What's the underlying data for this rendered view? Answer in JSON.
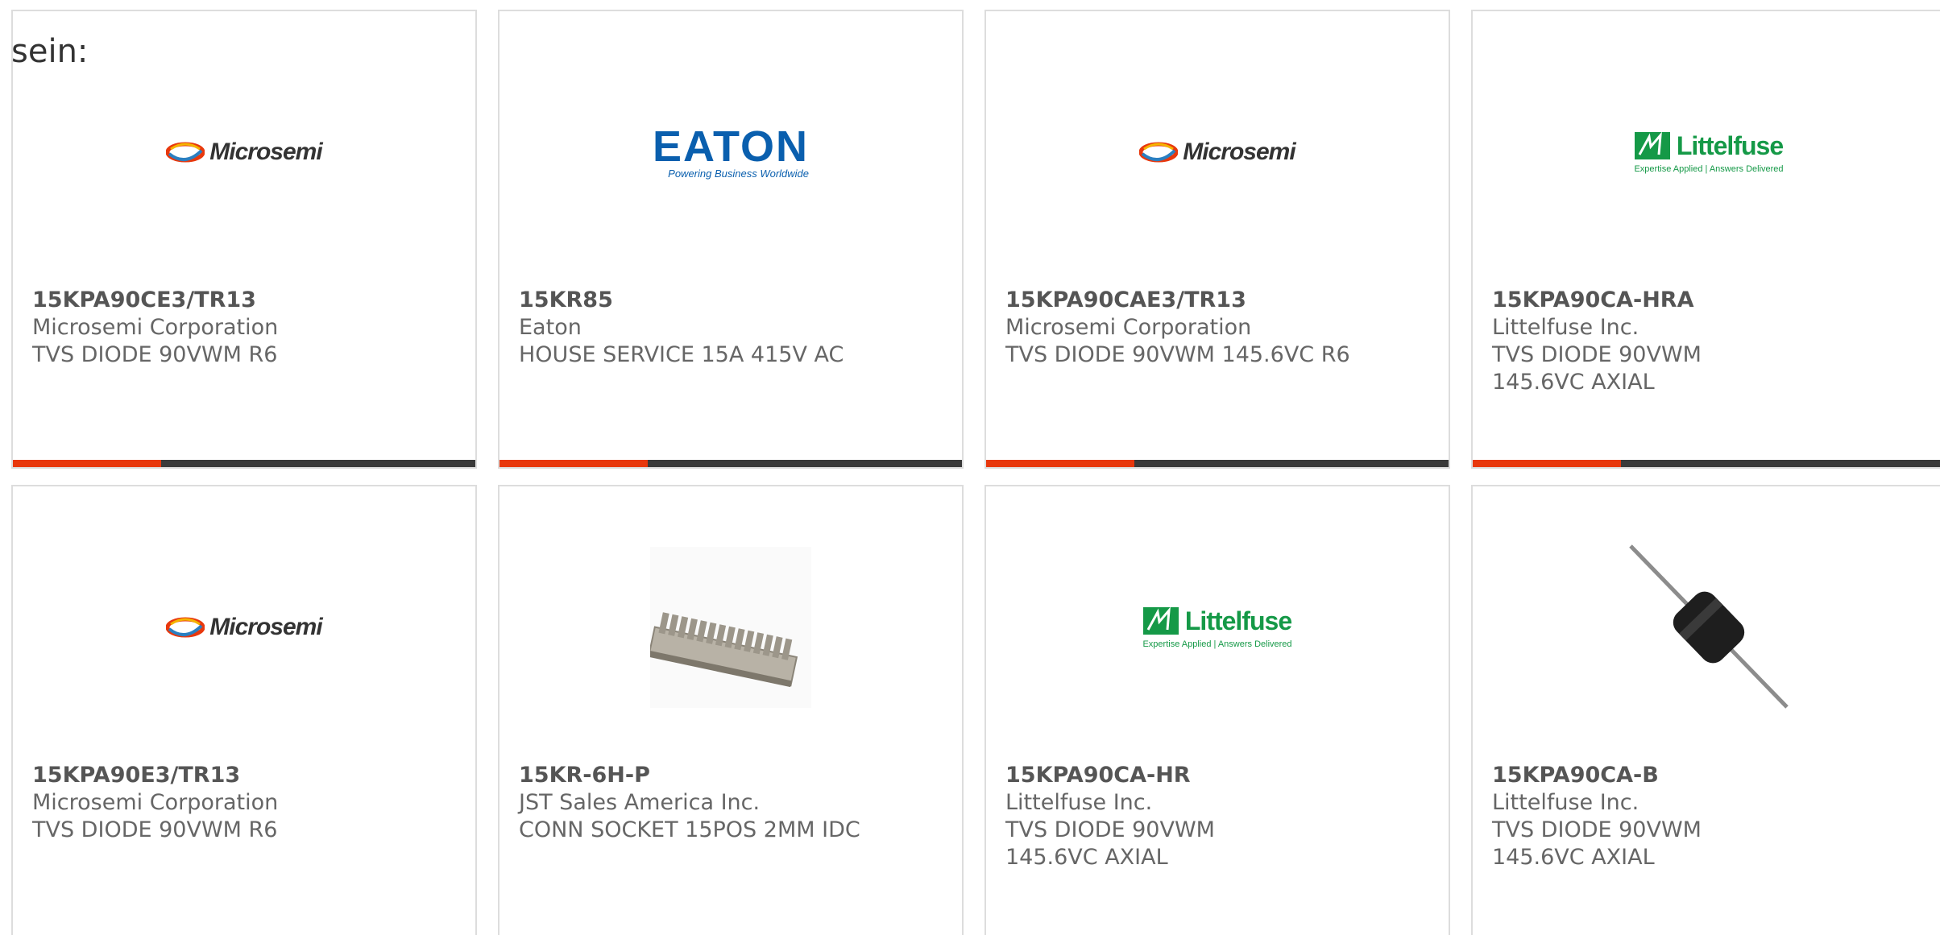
{
  "intro_text": "sein:",
  "accent_color": "#e8380d",
  "products": [
    {
      "part_number": "15KPA90CE3/TR13",
      "manufacturer": "Microsemi Corporation",
      "description": "TVS DIODE 90VWM R6",
      "image": "microsemi-logo",
      "logo_text": "Microsemi"
    },
    {
      "part_number": "15KR85",
      "manufacturer": "Eaton",
      "description": "HOUSE SERVICE 15A 415V AC",
      "image": "eaton-logo",
      "logo_text": "EATON",
      "logo_tagline": "Powering Business Worldwide"
    },
    {
      "part_number": "15KPA90CAE3/TR13",
      "manufacturer": "Microsemi Corporation",
      "description": "TVS DIODE 90VWM 145.6VC R6",
      "image": "microsemi-logo",
      "logo_text": "Microsemi"
    },
    {
      "part_number": "15KPA90CA-HRA",
      "manufacturer": "Littelfuse Inc.",
      "description": "TVS DIODE 90VWM 145.6VC AXIAL",
      "image": "littelfuse-logo",
      "logo_text": "Littelfuse",
      "logo_tagline": "Expertise Applied | Answers Delivered"
    },
    {
      "part_number": "15KPA90E3/TR13",
      "manufacturer": "Microsemi Corporation",
      "description": "TVS DIODE 90VWM R6",
      "image": "microsemi-logo",
      "logo_text": "Microsemi"
    },
    {
      "part_number": "15KR-6H-P",
      "manufacturer": "JST Sales America Inc.",
      "description": "CONN SOCKET 15POS 2MM IDC",
      "image": "connector-photo"
    },
    {
      "part_number": "15KPA90CA-HR",
      "manufacturer": "Littelfuse Inc.",
      "description": "TVS DIODE 90VWM 145.6VC AXIAL",
      "image": "littelfuse-logo",
      "logo_text": "Littelfuse",
      "logo_tagline": "Expertise Applied | Answers Delivered"
    },
    {
      "part_number": "15KPA90CA-B",
      "manufacturer": "Littelfuse Inc.",
      "description": "TVS DIODE 90VWM 145.6VC AXIAL",
      "image": "diode-photo"
    }
  ]
}
